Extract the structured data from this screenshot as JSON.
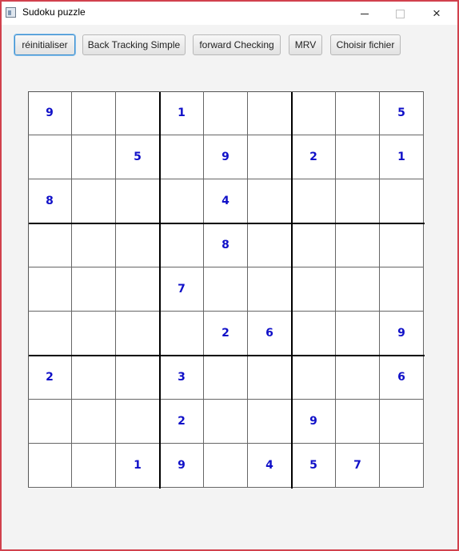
{
  "window": {
    "title": "Sudoku puzzle",
    "border_color": "#d1414d",
    "controls": {
      "minimize": "minimize-icon",
      "maximize": "maximize-icon",
      "close": "×"
    }
  },
  "toolbar": {
    "buttons": [
      {
        "label": "réinitialiser",
        "focused": true
      },
      {
        "label": "Back Tracking Simple",
        "focused": false
      },
      {
        "label": "forward Checking",
        "focused": false
      },
      {
        "label": "MRV",
        "focused": false
      },
      {
        "label": "Choisir fichier",
        "focused": false
      }
    ]
  },
  "grid": {
    "digit_color": "#1010c8",
    "rows": [
      [
        "9",
        "",
        "",
        "1",
        "",
        "",
        "",
        "",
        "5"
      ],
      [
        "",
        "",
        "5",
        "",
        "9",
        "",
        "2",
        "",
        "1"
      ],
      [
        "8",
        "",
        "",
        "",
        "4",
        "",
        "",
        "",
        ""
      ],
      [
        "",
        "",
        "",
        "",
        "8",
        "",
        "",
        "",
        ""
      ],
      [
        "",
        "",
        "",
        "7",
        "",
        "",
        "",
        "",
        ""
      ],
      [
        "",
        "",
        "",
        "",
        "2",
        "6",
        "",
        "",
        "9"
      ],
      [
        "2",
        "",
        "",
        "3",
        "",
        "",
        "",
        "",
        "6"
      ],
      [
        "",
        "",
        "",
        "2",
        "",
        "",
        "9",
        "",
        ""
      ],
      [
        "",
        "",
        "1",
        "9",
        "",
        "4",
        "5",
        "7",
        ""
      ]
    ]
  }
}
